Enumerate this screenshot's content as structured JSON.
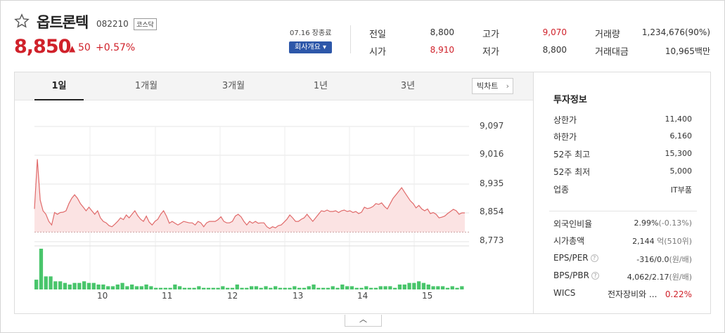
{
  "header": {
    "star_icon": "star-outline-icon",
    "name": "옵트론텍",
    "code": "082210",
    "market": "코스닥",
    "price": "8,850",
    "change_arrow": "▲",
    "change_value": "50",
    "change_percent": "+0.57%",
    "close_time": "07.16 장종료",
    "company_button": "회사개요 ▾"
  },
  "quote": {
    "prev_label": "전일",
    "prev_value": "8,800",
    "open_label": "시가",
    "open_value": "8,910",
    "high_label": "고가",
    "high_value": "9,070",
    "low_label": "저가",
    "low_value": "8,800",
    "volume_label": "거래량",
    "volume_value": "1,234,676(90%)",
    "amount_label": "거래대금",
    "amount_value": "10,965백만"
  },
  "tabs": [
    "1일",
    "1개월",
    "3개월",
    "1년",
    "3년"
  ],
  "active_tab": "1일",
  "big_chart_button": "빅차트",
  "colors": {
    "up": "#d0212a",
    "down": "#1e5ec8",
    "line": "#e06a6a",
    "area": "#fbe3e3",
    "volume": "#49c56b"
  },
  "chart_data": {
    "type": "area",
    "title": "",
    "y_ticks": [
      "9,097",
      "9,016",
      "8,935",
      "8,854",
      "8,773"
    ],
    "ylim": [
      8773,
      9097
    ],
    "x_ticks": [
      "10",
      "11",
      "12",
      "13",
      "14",
      "15"
    ],
    "baseline": 8800,
    "price_series": [
      8865,
      9005,
      8890,
      8860,
      8850,
      8830,
      8820,
      8855,
      8850,
      8855,
      8856,
      8860,
      8880,
      8895,
      8905,
      8895,
      8880,
      8870,
      8860,
      8870,
      8860,
      8850,
      8860,
      8840,
      8830,
      8826,
      8818,
      8815,
      8822,
      8830,
      8840,
      8835,
      8848,
      8840,
      8850,
      8860,
      8846,
      8836,
      8830,
      8845,
      8828,
      8820,
      8830,
      8836,
      8850,
      8860,
      8845,
      8825,
      8830,
      8825,
      8820,
      8825,
      8830,
      8828,
      8826,
      8826,
      8820,
      8830,
      8826,
      8815,
      8826,
      8830,
      8830,
      8830,
      8835,
      8843,
      8830,
      8826,
      8826,
      8830,
      8845,
      8850,
      8843,
      8830,
      8820,
      8830,
      8825,
      8830,
      8825,
      8826,
      8826,
      8815,
      8810,
      8815,
      8812,
      8818,
      8820,
      8828,
      8836,
      8848,
      8840,
      8830,
      8830,
      8836,
      8840,
      8850,
      8840,
      8830,
      8840,
      8850,
      8860,
      8858,
      8862,
      8858,
      8858,
      8860,
      8855,
      8860,
      8862,
      8858,
      8860,
      8855,
      8858,
      8852,
      8856,
      8870,
      8866,
      8868,
      8872,
      8880,
      8878,
      8882,
      8872,
      8865,
      8880,
      8895,
      8905,
      8915,
      8925,
      8912,
      8900,
      8888,
      8880,
      8868,
      8875,
      8865,
      8860,
      8865,
      8852,
      8855,
      8850,
      8840,
      8842,
      8845,
      8852,
      8858,
      8864,
      8860,
      8850,
      8854,
      8854
    ],
    "volume_series": [
      12,
      50,
      16,
      16,
      10,
      10,
      8,
      6,
      8,
      8,
      10,
      8,
      8,
      6,
      6,
      4,
      4,
      6,
      8,
      4,
      6,
      4,
      4,
      6,
      4,
      2,
      2,
      2,
      2,
      6,
      4,
      2,
      2,
      2,
      4,
      2,
      2,
      2,
      2,
      4,
      2,
      2,
      6,
      2,
      2,
      4,
      4,
      2,
      4,
      2,
      4,
      2,
      2,
      2,
      4,
      2,
      2,
      4,
      6,
      2,
      2,
      2,
      4,
      2,
      6,
      4,
      4,
      2,
      2,
      4,
      2,
      2,
      4,
      4,
      4,
      2,
      6,
      6,
      8,
      8,
      10,
      8,
      6,
      4,
      4,
      4,
      2,
      4,
      2,
      4
    ]
  },
  "info": {
    "title": "투자정보",
    "upper_limit_label": "상한가",
    "upper_limit_value": "11,400",
    "lower_limit_label": "하한가",
    "lower_limit_value": "6,160",
    "high52_label": "52주 최고",
    "high52_value": "15,300",
    "low52_label": "52주 최저",
    "low52_value": "5,000",
    "industry_label": "업종",
    "industry_value": "IT부품",
    "foreign_label": "외국인비율",
    "foreign_value": "2.99%",
    "foreign_change": "(-0.13%)",
    "mcap_label": "시가총액",
    "mcap_value": "2,144",
    "mcap_unit": "억",
    "mcap_rank": "(510위)",
    "eps_label": "EPS/PER",
    "eps_value": "-316/0.0",
    "eps_unit": "(원/배)",
    "bps_label": "BPS/PBR",
    "bps_value": "4,062/2.17",
    "bps_unit": "(원/배)",
    "wics_label": "WICS",
    "wics_value": "전자장비와 ...",
    "wics_change": "0.22%"
  },
  "collapse_icon": "chevron-up-icon"
}
